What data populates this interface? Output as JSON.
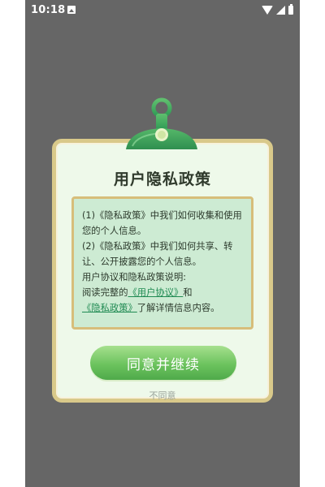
{
  "status_bar": {
    "time": "10:18",
    "notification_icon": "notification-icon",
    "wifi_icon": "wifi-icon",
    "signal_icon": "signal-icon",
    "battery_icon": "battery-icon"
  },
  "dialog": {
    "title": "用户隐私政策",
    "clip_icon": "clipboard-clip-icon",
    "policy": {
      "line1": "(1)《隐私政策》中我们如何收集和使用您的个人信息。",
      "line2": "(2)《隐私政策》中我们如何共享、转让、公开披露您的个人信息。",
      "line3": "用户协议和隐私政策说明:",
      "line4_prefix": "阅读完整的",
      "link_user_agreement": "《用户协议》",
      "line4_middle": "和",
      "link_privacy_policy": "《隐私政策》",
      "line4_suffix": "了解详情信息内容。"
    },
    "agree_button": "同意并继续",
    "disagree_link": "不同意"
  },
  "colors": {
    "background": "#666666",
    "dialog_bg": "#eef9ea",
    "dialog_border": "#d9c98a",
    "policy_bg": "#cdebd3",
    "accent_green": "#6cc35e",
    "link_green": "#1f8a52"
  }
}
